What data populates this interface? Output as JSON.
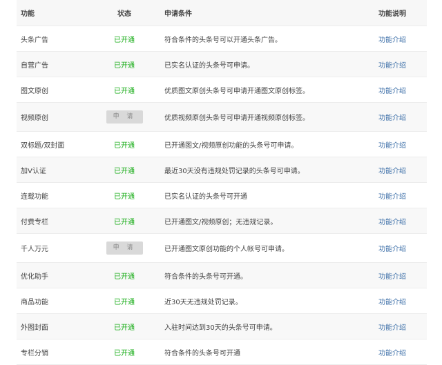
{
  "header": {
    "feature": "功能",
    "status": "状态",
    "condition": "申请条件",
    "description": "功能说明"
  },
  "rows": [
    {
      "feature": "头条广告",
      "status": "已开通",
      "status_type": "opened",
      "condition": "符合条件的头条号可以开通头条广告。",
      "link": "功能介绍"
    },
    {
      "feature": "自营广告",
      "status": "已开通",
      "status_type": "opened",
      "condition": "已实名认证的头条号可申请。",
      "link": "功能介绍"
    },
    {
      "feature": "图文原创",
      "status": "已开通",
      "status_type": "opened",
      "condition": "优质图文原创头条号可申请开通图文原创标签。",
      "link": "功能介绍"
    },
    {
      "feature": "视频原创",
      "status": "申 请",
      "status_type": "apply",
      "condition": "优质视频原创头条号可申请开通视频原创标签。",
      "link": "功能介绍"
    },
    {
      "feature": "双标题/双封面",
      "status": "已开通",
      "status_type": "opened",
      "condition": "已开通图文/视频原创功能的头条号可申请。",
      "link": "功能介绍"
    },
    {
      "feature": "加V认证",
      "status": "已开通",
      "status_type": "opened",
      "condition": "最近30天没有违规处罚记录的头条号可申请。",
      "link": "功能介绍"
    },
    {
      "feature": "连载功能",
      "status": "已开通",
      "status_type": "opened",
      "condition": "已实名认证的头条号可开通",
      "link": "功能介绍"
    },
    {
      "feature": "付费专栏",
      "status": "已开通",
      "status_type": "opened",
      "condition": "已开通图文/视频原创；无违规记录。",
      "link": "功能介绍"
    },
    {
      "feature": "千人万元",
      "status": "申 请",
      "status_type": "apply",
      "condition": "已开通图文原创功能的个人帐号可申请。",
      "link": "功能介绍"
    },
    {
      "feature": "优化助手",
      "status": "已开通",
      "status_type": "opened",
      "condition": "符合条件的头条号可开通。",
      "link": "功能介绍"
    },
    {
      "feature": "商品功能",
      "status": "已开通",
      "status_type": "opened",
      "condition": "近30天无违规处罚记录。",
      "link": "功能介绍"
    },
    {
      "feature": "外图封面",
      "status": "已开通",
      "status_type": "opened",
      "condition": "入驻时间达到30天的头条号可申请。",
      "link": "功能介绍"
    },
    {
      "feature": "专栏分销",
      "status": "已开通",
      "status_type": "opened",
      "condition": "符合条件的头条号可开通",
      "link": "功能介绍"
    }
  ]
}
